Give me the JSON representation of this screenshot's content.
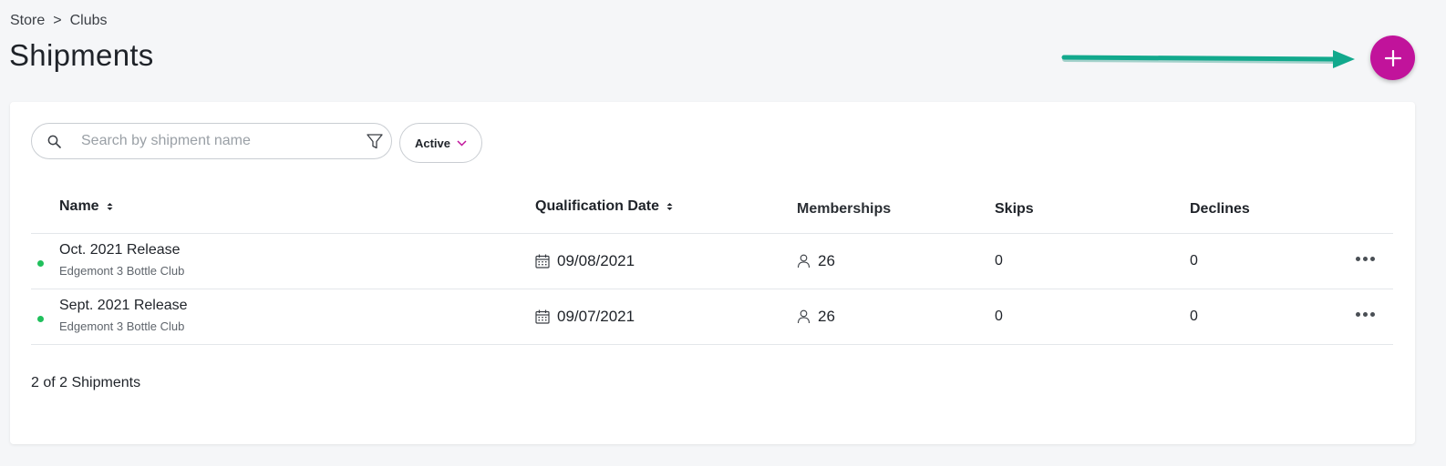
{
  "breadcrumb": {
    "items": [
      "Store",
      "Clubs"
    ],
    "separator": ">"
  },
  "page": {
    "title": "Shipments"
  },
  "colors": {
    "accent": "#c1139b",
    "active_dot": "#20c05c",
    "arrow": "#12a98d"
  },
  "search": {
    "placeholder": "Search by shipment name",
    "value": ""
  },
  "status_filter": {
    "selected": "Active"
  },
  "table": {
    "columns": {
      "name": "Name",
      "qualification_date": "Qualification Date",
      "memberships": "Memberships",
      "skips": "Skips",
      "declines": "Declines"
    },
    "rows": [
      {
        "name": "Oct. 2021 Release",
        "club": "Edgemont 3 Bottle Club",
        "date": "09/08/2021",
        "memberships": "26",
        "skips": "0",
        "declines": "0",
        "status": "active"
      },
      {
        "name": "Sept. 2021 Release",
        "club": "Edgemont 3 Bottle Club",
        "date": "09/07/2021",
        "memberships": "26",
        "skips": "0",
        "declines": "0",
        "status": "active"
      }
    ]
  },
  "footer": {
    "count_text": "2 of 2 Shipments"
  }
}
